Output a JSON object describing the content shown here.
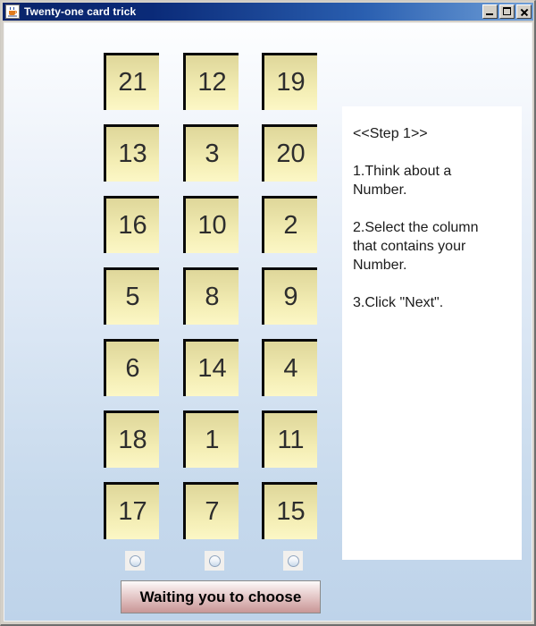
{
  "window": {
    "title": "Twenty-one card trick",
    "icon": "java-coffee-cup-icon",
    "minimize_label": "Minimize",
    "maximize_label": "Maximize",
    "close_label": "Close"
  },
  "cards": {
    "columns": [
      {
        "name": "column-1",
        "values": [
          "21",
          "13",
          "16",
          "5",
          "6",
          "18",
          "17"
        ]
      },
      {
        "name": "column-2",
        "values": [
          "12",
          "3",
          "10",
          "8",
          "14",
          "1",
          "7"
        ]
      },
      {
        "name": "column-3",
        "values": [
          "19",
          "20",
          "2",
          "9",
          "4",
          "11",
          "15"
        ]
      }
    ]
  },
  "instructions": {
    "text": "<<Step 1>>\n\n1.Think about a\nNumber.\n\n2.Select the column\nthat contains your\nNumber.\n\n3.Click \"Next\"."
  },
  "radios": [
    {
      "name": "radio-column-1",
      "selected": false
    },
    {
      "name": "radio-column-2",
      "selected": false
    },
    {
      "name": "radio-column-3",
      "selected": false
    }
  ],
  "action_button": {
    "label": "Waiting you to choose"
  },
  "colors": {
    "titlebar_start": "#0a246a",
    "titlebar_end": "#6f9fd8",
    "card_top": "#dfd79a",
    "card_bottom": "#fcf7c6",
    "panel_bg": "#ffffff",
    "button_top": "#fdfbfb",
    "button_bottom": "#c89898"
  }
}
